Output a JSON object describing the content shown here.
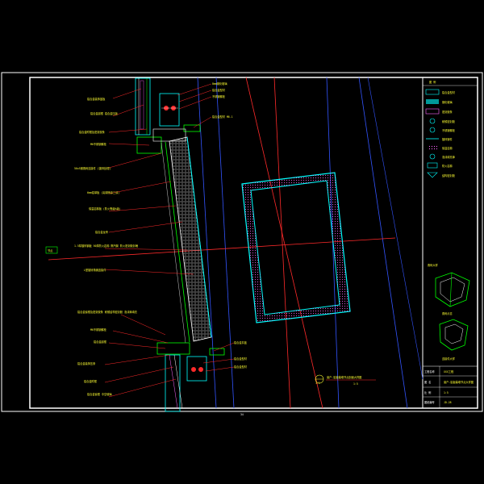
{
  "drawing": {
    "annotations_left": [
      "铝合金装饰盖板",
      "铝合金副框 铝合金压板",
      "铝合金附框及密封胶条",
      "M6不锈钢螺栓",
      "50x5钢角码连接件 (镀锌处理)",
      "6mm铝单板 (氟碳喷涂三涂)",
      "保温岩棉板 (防火等级A级)",
      "铝合金龙骨",
      "1.5厚镀锌钢板 50厚防火岩棉 隔汽膜 防火密封胶封堵",
      "L型镀锌角钢连接件",
      "铝合金窗框及密封胶条 耐候结构密封胶 泡沫棒填充",
      "M6不锈钢螺栓",
      "铝合金副框",
      "铝合金装饰压条",
      "铝合金附框",
      "铝合金窗框 中空玻璃"
    ],
    "annotations_right": [
      "8mm钢化玻璃",
      "铝合金型材",
      "不锈钢螺栓",
      "铝合金型材 M6-1",
      "铝合金扣盖",
      "铝合金型材",
      "铝合金型材"
    ],
    "left_tag": "节点",
    "section_caption": "窗户-铝板幕墙节点剖面大样图",
    "section_scale": "1:5",
    "section_number": "1-1",
    "bottom_caption": "34",
    "legend": {
      "title": "图 例",
      "items": [
        "铝合金型材",
        "钢化玻璃",
        "密封胶条",
        "耐候密封胶",
        "不锈钢螺栓",
        "镀锌钢件",
        "保温岩棉",
        "泡沫填充棒",
        "防火岩棉",
        "结构密封胶"
      ]
    },
    "iso": {
      "title": "角码大样",
      "label1": "角码示意",
      "label2": "连接件大样"
    },
    "title_block": {
      "project_label": "工程名称",
      "project_value": "XXX工程",
      "drawing_label": "图 名",
      "drawing_value": "窗户-铝板幕墙节点大样图",
      "scale_label": "比 例",
      "scale_value": "1:5",
      "number_label": "图纸编号",
      "number_value": "JD-28"
    }
  }
}
